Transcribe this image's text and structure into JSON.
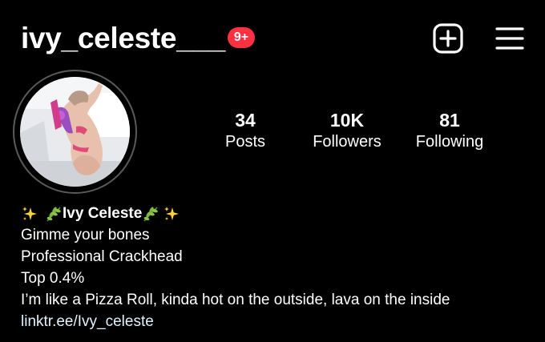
{
  "header": {
    "username": "ivy_celeste___",
    "notification_badge": "9+",
    "new_post_icon": "plus-square-icon",
    "menu_icon": "hamburger-menu-icon"
  },
  "profile": {
    "avatar": "profile-photo"
  },
  "stats": {
    "posts": {
      "count": "34",
      "label": "Posts"
    },
    "followers": {
      "count": "10K",
      "label": "Followers"
    },
    "following": {
      "count": "81",
      "label": "Following"
    }
  },
  "bio": {
    "display_name": "Ivy Celeste",
    "lines": [
      "Gimme your bones",
      "Professional Crackhead",
      "Top 0.4%",
      "I’m like a Pizza Roll, kinda hot on the outside, lava on the inside"
    ],
    "link": "linktr.ee/Ivy_celeste"
  },
  "colors": {
    "background": "#000000",
    "text": "#ffffff",
    "badge": "#ff3040",
    "link": "#e0f1ff",
    "avatar_ring": "#5a5a5a"
  }
}
